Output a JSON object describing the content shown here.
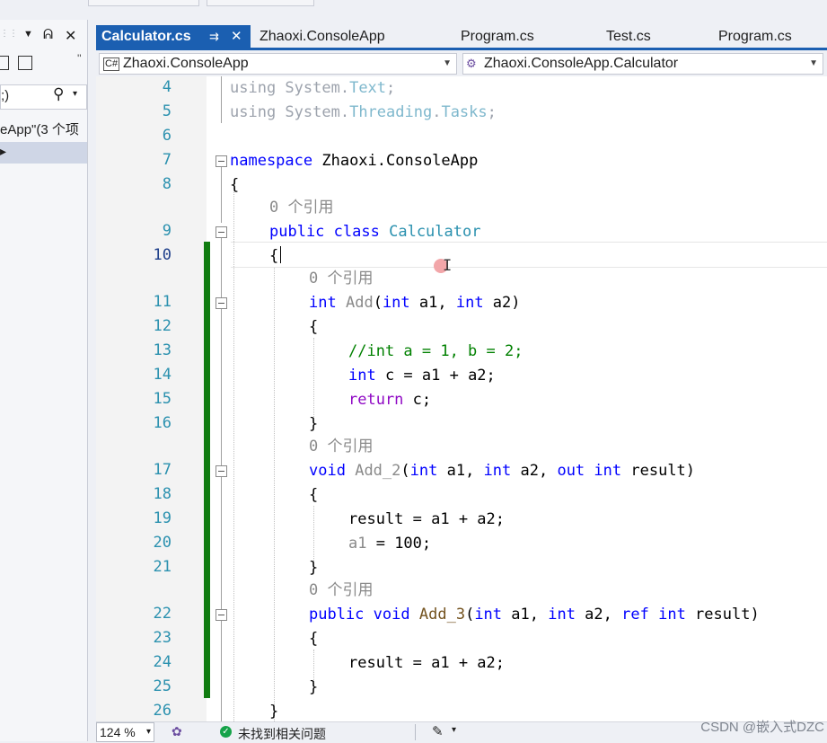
{
  "tabs": [
    {
      "label": "Calculator.cs",
      "active": true
    },
    {
      "label": "Zhaoxi.ConsoleApp",
      "active": false
    },
    {
      "label": "Program.cs",
      "active": false
    },
    {
      "label": "Test.cs",
      "active": false
    },
    {
      "label": "Program.cs",
      "active": false
    }
  ],
  "tab_icons": {
    "pin": "⇉",
    "close": "✕"
  },
  "navbar": {
    "project": "Zhaoxi.ConsoleApp",
    "project_icon": "C#",
    "member": "Zhaoxi.ConsoleApp.Calculator",
    "member_icon": "class-icon"
  },
  "left_panel": {
    "pin": "ᕱ",
    "close": "✕",
    "search_text": ";)",
    "tree_item": "eApp\"(3 个项",
    "tree_glyph": "▸"
  },
  "references_lens": "0 个引用",
  "line_numbers": [
    "4",
    "5",
    "6",
    "7",
    "8",
    "9",
    "10",
    "11",
    "12",
    "13",
    "14",
    "15",
    "16",
    "17",
    "18",
    "19",
    "20",
    "21",
    "22",
    "23",
    "24",
    "25",
    "26"
  ],
  "code": {
    "l4": [
      "using",
      " System.",
      "Text",
      ";"
    ],
    "l5": [
      "using",
      " System.",
      "Threading",
      ".",
      "Tasks",
      ";"
    ],
    "l7": [
      "namespace",
      " Zhaoxi.ConsoleApp"
    ],
    "l8": "{",
    "l9": [
      "public",
      " ",
      "class",
      " ",
      "Calculator"
    ],
    "l10": "{",
    "l11": [
      "int",
      " ",
      "Add",
      "(",
      "int",
      " a1, ",
      "int",
      " a2)"
    ],
    "l12": "{",
    "l13": "//int a = 1, b = 2;",
    "l14": [
      "int",
      " c = a1 + a2;"
    ],
    "l15": [
      "return",
      " c;"
    ],
    "l16": "}",
    "l17": [
      "void",
      " ",
      "Add_2",
      "(",
      "int",
      " a1, ",
      "int",
      " a2, ",
      "out",
      " ",
      "int",
      " result)"
    ],
    "l18": "{",
    "l19": "result = a1 + a2;",
    "l20": [
      "a1",
      " = 100;"
    ],
    "l21": "}",
    "l22": [
      "public",
      " ",
      "void",
      " ",
      "Add_3",
      "(",
      "int",
      " a1, ",
      "int",
      " a2, ",
      "ref",
      " ",
      "int",
      " result)"
    ],
    "l23": "{",
    "l24": "result = a1 + a2;",
    "l25": "}",
    "l26": "}"
  },
  "status": {
    "zoom": "124 %",
    "issues": "未找到相关问题",
    "ok_icon": "✓",
    "brush_icon": "✎",
    "dd": "▾"
  },
  "watermark": "CSDN @嵌入式DZC",
  "colors": {
    "accent": "#1b5fb1",
    "change_bar": "#107c10",
    "keyword": "#0000ff",
    "type": "#2b91af",
    "comment": "#008000"
  }
}
